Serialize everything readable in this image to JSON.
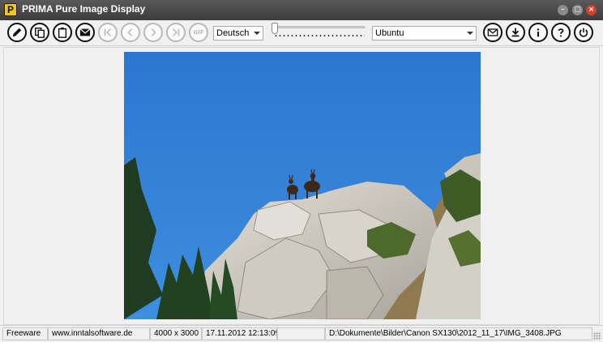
{
  "window": {
    "title": "PRIMA Pure Image Display",
    "icon_letter": "P",
    "minimize_glyph": "–",
    "maximize_glyph": "□",
    "close_glyph": "×"
  },
  "toolbar": {
    "left_buttons": [
      {
        "name": "edit-button",
        "icon": "pencil-icon",
        "enabled": true
      },
      {
        "name": "copy-button",
        "icon": "copy-icon",
        "enabled": true
      },
      {
        "name": "paste-button",
        "icon": "clipboard-icon",
        "enabled": true
      },
      {
        "name": "email-button",
        "icon": "envelope-icon",
        "enabled": true
      },
      {
        "name": "first-image-button",
        "icon": "skip-first-icon",
        "enabled": false
      },
      {
        "name": "previous-image-button",
        "icon": "chevron-left-icon",
        "enabled": false
      },
      {
        "name": "next-image-button",
        "icon": "chevron-right-icon",
        "enabled": false
      },
      {
        "name": "last-image-button",
        "icon": "skip-last-icon",
        "enabled": false
      },
      {
        "name": "gif-button",
        "icon": "gif-icon",
        "enabled": false
      }
    ],
    "gif_label": "GIF",
    "language_select": {
      "value": "Deutsch"
    },
    "zoom_slider": {
      "level": 0.0
    },
    "font_select": {
      "value": "Ubuntu"
    },
    "right_buttons": [
      {
        "name": "mail-button",
        "icon": "envelope-icon"
      },
      {
        "name": "download-button",
        "icon": "download-icon"
      },
      {
        "name": "info-button",
        "icon": "info-icon"
      },
      {
        "name": "help-button",
        "icon": "question-icon"
      },
      {
        "name": "power-button",
        "icon": "power-icon"
      }
    ]
  },
  "image": {
    "subject": "photo-chamois-on-rock"
  },
  "statusbar": {
    "license": "Freeware",
    "website": "www.inntalsoftware.de",
    "dimensions": "4000 x 3000",
    "datetime": "17.11.2012 12:13:09",
    "empty": "",
    "filepath": "D:\\Dokumente\\Bilder\\Canon SX130\\2012_11_17\\IMG_3408.JPG"
  },
  "colors": {
    "titlebar": "#4a4a4a",
    "sky": "#2f7fd6",
    "rock": "#d9d6cf",
    "close": "#d4402c",
    "app_icon": "#f2c61f"
  }
}
